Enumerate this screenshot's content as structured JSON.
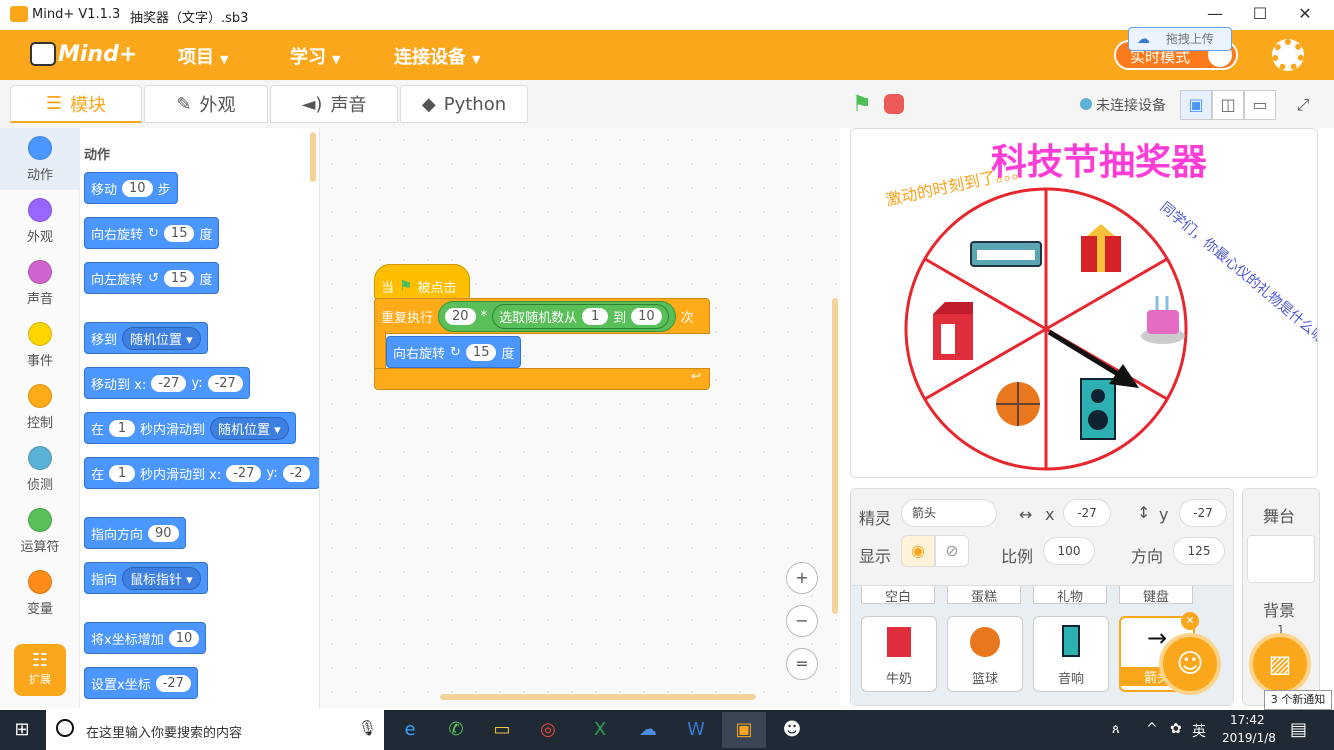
{
  "window": {
    "app_title": "Mind+ V1.1.3",
    "file_title": "抽奖器（文字）.sb3",
    "minimize": "—",
    "maximize": "☐",
    "close": "✕"
  },
  "header": {
    "logo": "Mind+",
    "menus": [
      {
        "label": "项目"
      },
      {
        "label": "学习"
      },
      {
        "label": "连接设备"
      }
    ],
    "mode_label": "实时模式",
    "upload_label": "拖拽上传"
  },
  "tabs": [
    {
      "label": "模块"
    },
    {
      "label": "外观"
    },
    {
      "label": "声音"
    },
    {
      "label": "Python"
    }
  ],
  "categories": [
    {
      "label": "动作",
      "color": "#4c97ff"
    },
    {
      "label": "外观",
      "color": "#9966ff"
    },
    {
      "label": "声音",
      "color": "#cf63cf"
    },
    {
      "label": "事件",
      "color": "#ffd500"
    },
    {
      "label": "控制",
      "color": "#ffab19"
    },
    {
      "label": "侦测",
      "color": "#5cb1d6"
    },
    {
      "label": "运算符",
      "color": "#59c059"
    },
    {
      "label": "变量",
      "color": "#ff8c1a"
    }
  ],
  "extension_label": "扩展",
  "palette": {
    "section": "动作",
    "move": {
      "a": "移动",
      "v": "10",
      "b": "步"
    },
    "turn_right": {
      "a": "向右旋转",
      "v": "15",
      "b": "度"
    },
    "turn_left": {
      "a": "向左旋转",
      "v": "15",
      "b": "度"
    },
    "goto": {
      "a": "移到",
      "d": "随机位置"
    },
    "goto_xy": {
      "a": "移动到 x:",
      "x": "-27",
      "b": "y:",
      "y": "-27"
    },
    "glide": {
      "a": "在",
      "v": "1",
      "b": "秒内滑动到",
      "d": "随机位置"
    },
    "glide_xy": {
      "a": "在",
      "v": "1",
      "b": "秒内滑动到 x:",
      "x": "-27",
      "c": "y:",
      "y": "-2"
    },
    "point_dir": {
      "a": "指向方向",
      "v": "90"
    },
    "point_to": {
      "a": "指向",
      "d": "鼠标指针"
    },
    "change_x": {
      "a": "将x坐标增加",
      "v": "10"
    },
    "set_x": {
      "a": "设置x坐标",
      "v": "-27"
    }
  },
  "script": {
    "hat_a": "当",
    "hat_b": "被点击",
    "repeat_a": "重复执行",
    "times_v": "20",
    "mult": "*",
    "rand_a": "选取随机数从",
    "rand_from": "1",
    "rand_to_label": "到",
    "rand_to": "10",
    "repeat_b": "次",
    "turn_a": "向右旋转",
    "turn_v": "15",
    "turn_b": "度"
  },
  "zoom": {
    "in": "+",
    "out": "−",
    "reset": "="
  },
  "rightbar": {
    "status": "未连接设备"
  },
  "stage": {
    "title": "科技节抽奖器",
    "left_text": "激动的时刻到了。。。",
    "right_text": "同学们，你最心仪的礼物是什么呢？"
  },
  "sprite_panel": {
    "sprite_label": "精灵",
    "sprite_name": "箭头",
    "x_label": "x",
    "x": "-27",
    "y_label": "y",
    "y": "-27",
    "show_label": "显示",
    "size_label": "比例",
    "size": "100",
    "dir_label": "方向",
    "dir": "125",
    "top_row": [
      "空白",
      "蛋糕",
      "礼物",
      "键盘"
    ],
    "thumbs": [
      {
        "label": "牛奶"
      },
      {
        "label": "篮球"
      },
      {
        "label": "音响"
      },
      {
        "label": "箭头"
      }
    ]
  },
  "stage_panel": {
    "title": "舞台",
    "backdrop_label": "背景",
    "backdrop_count": "1"
  },
  "notification": "3 个新通知",
  "taskbar": {
    "search": "在这里输入你要搜索的内容",
    "ime": "英",
    "time": "17:42",
    "date": "2019/1/8"
  }
}
